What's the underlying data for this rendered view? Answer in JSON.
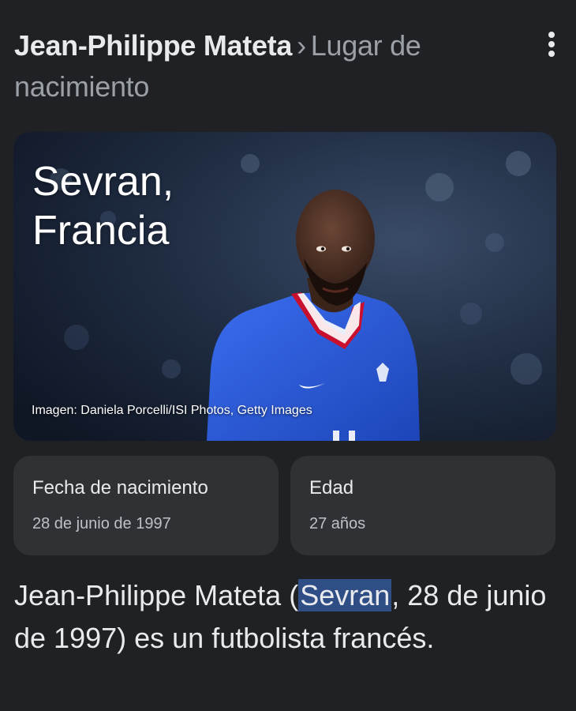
{
  "header": {
    "entity": "Jean-Philippe Mateta",
    "separator": "›",
    "attribute": "Lugar de nacimiento",
    "more_icon": "more-vert-icon"
  },
  "hero": {
    "title_line1": "Sevran,",
    "title_line2": "Francia",
    "credit": "Imagen: Daniela Porcelli/ISI Photos, Getty Images"
  },
  "facts": [
    {
      "label": "Fecha de nacimiento",
      "value": "28 de junio de 1997"
    },
    {
      "label": "Edad",
      "value": "27 años"
    }
  ],
  "snippet": {
    "before": "Jean-Philippe Mateta (",
    "highlight": "Sevran",
    "after": ", 28 de junio de 1997) es un futbolista francés."
  },
  "colors": {
    "background": "#202124",
    "card": "#303134",
    "highlight": "#2f4e86",
    "jersey": "#2a5bd7"
  }
}
